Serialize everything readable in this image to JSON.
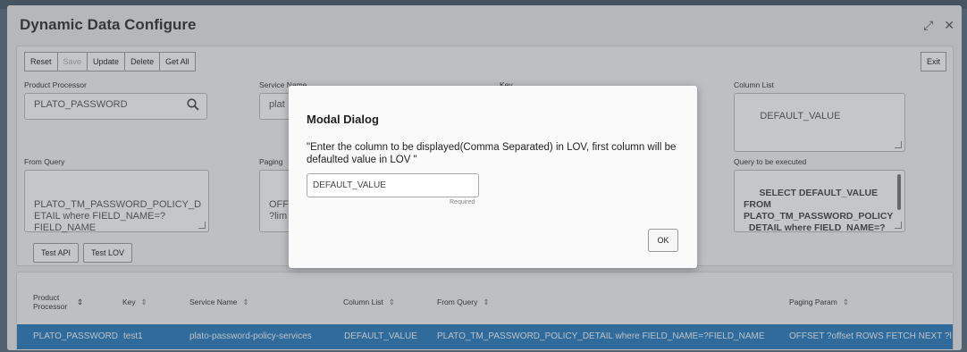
{
  "window": {
    "title": "Dynamic Data Configure"
  },
  "toolbar": {
    "reset": "Reset",
    "save": "Save",
    "update": "Update",
    "delete": "Delete",
    "get_all": "Get All",
    "exit": "Exit"
  },
  "form": {
    "product_processor": {
      "label": "Product Processor",
      "value": "PLATO_PASSWORD"
    },
    "service_name": {
      "label": "Service Name",
      "value": "plat"
    },
    "key": {
      "label": "Key"
    },
    "column_list": {
      "label": "Column List",
      "value": "DEFAULT_VALUE"
    },
    "from_query": {
      "label": "From Query",
      "value": "PLATO_TM_PASSWORD_POLICY_D\nETAIL where FIELD_NAME=?\nFIELD_NAME"
    },
    "paging_param": {
      "label": "Paging",
      "value": "OFF\n?lim"
    },
    "query_executed": {
      "label": "Query to be executed",
      "value": "SELECT DEFAULT_VALUE FROM\nPLATO_TM_PASSWORD_POLICY\n_DETAIL where FIELD_NAME=?\nFIELD_NAME OFFSET ?offset\nROWS FETCH NEXT ?limit ROWS"
    },
    "test_api": "Test API",
    "test_lov": "Test LOV"
  },
  "table": {
    "headers": [
      "Product\nProcessor",
      "Key",
      "Service Name",
      "Column List",
      "From Query",
      "Paging Param"
    ],
    "rows": [
      [
        "PLATO_PASSWORD",
        "test1",
        "plato-password-policy-services",
        "DEFAULT_VALUE",
        "PLATO_TM_PASSWORD_POLICY_DETAIL where FIELD_NAME=?FIELD_NAME",
        "OFFSET ?offset ROWS FETCH NEXT ?l"
      ]
    ]
  },
  "modal": {
    "title": "Modal Dialog",
    "message": "\"Enter the column to be displayed(Comma Separated) in LOV, first column will be defaulted value in LOV \"",
    "input_value": "DEFAULT_VALUE",
    "required": "Required",
    "ok": "OK"
  },
  "colors": {
    "selected_row": "#2b7bb9",
    "background": "#e4e4e4"
  }
}
